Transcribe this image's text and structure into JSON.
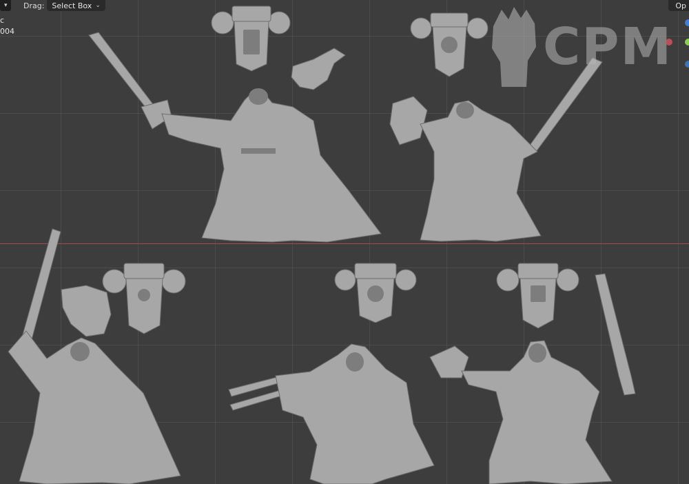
{
  "header": {
    "drag_label": "Drag:",
    "drag_value": "Select Box",
    "options_label": "Op"
  },
  "overlay": {
    "line1": "c",
    "line2": "004"
  },
  "watermark": {
    "text": "CPM",
    "icon": "raised-fist-icon"
  },
  "colors": {
    "viewport_bg": "#3d3d3d",
    "x_axis": "#a34a52",
    "model": "#a9a9a9",
    "gizmo_blue": "#3f7fd8",
    "gizmo_green": "#8ad14a",
    "gizmo_red": "#d8545f"
  },
  "scene": {
    "objects": [
      "backpack-1",
      "gun-1",
      "miniature-sword-1",
      "backpack-2",
      "miniature-chainsword-1",
      "gun-2",
      "backpack-3",
      "miniature-chainsword-2",
      "backpack-4",
      "miniature-claw",
      "backpack-5",
      "chainsword-loose",
      "miniature-pistol"
    ]
  }
}
